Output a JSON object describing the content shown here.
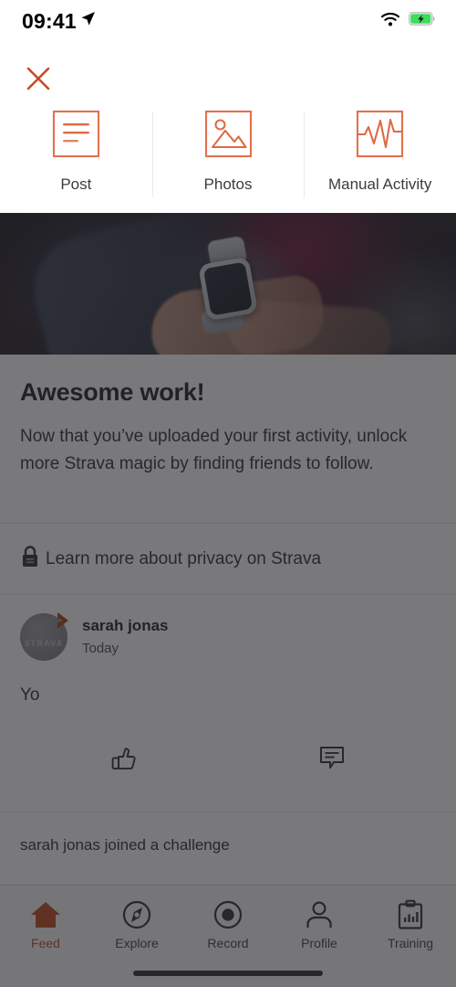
{
  "status_bar": {
    "time": "09:41",
    "location_icon": "location-arrow-icon",
    "wifi_icon": "wifi-icon",
    "battery_icon": "battery-charging-icon"
  },
  "action_sheet": {
    "close_label": "✕",
    "close_icon": "close-icon",
    "items": [
      {
        "label": "Post",
        "icon": "post-lines-icon"
      },
      {
        "label": "Photos",
        "icon": "photo-image-icon"
      },
      {
        "label": "Manual Activity",
        "icon": "activity-chart-icon"
      }
    ]
  },
  "promo": {
    "hero_image_alt": "person-using-smartwatch",
    "title": "Awesome work!",
    "body": "Now that you’ve uploaded your first activity, unlock more Strava magic by finding friends to follow.",
    "privacy_link": "Learn more about privacy on Strava",
    "privacy_icon": "lock-icon"
  },
  "feed": {
    "post": {
      "avatar_text": "STRAVA",
      "avatar_badge_icon": "chevron-badge-icon",
      "author": "sarah jonas",
      "date": "Today",
      "text": "Yo",
      "kudos_icon": "thumbs-up-icon",
      "comment_icon": "comment-bubble-icon"
    },
    "challenge_entry": "sarah jonas joined a challenge"
  },
  "tab_bar": {
    "active": "Feed",
    "tabs": [
      {
        "label": "Feed",
        "icon": "home-icon"
      },
      {
        "label": "Explore",
        "icon": "compass-icon"
      },
      {
        "label": "Record",
        "icon": "record-circle-icon"
      },
      {
        "label": "Profile",
        "icon": "person-icon"
      },
      {
        "label": "Training",
        "icon": "clipboard-chart-icon"
      }
    ]
  },
  "colors": {
    "accent": "#E75D33",
    "accent_dark": "#C0441C",
    "battery_green": "#3ddc5b",
    "dim_overlay": "rgba(38,38,42,.62)"
  }
}
